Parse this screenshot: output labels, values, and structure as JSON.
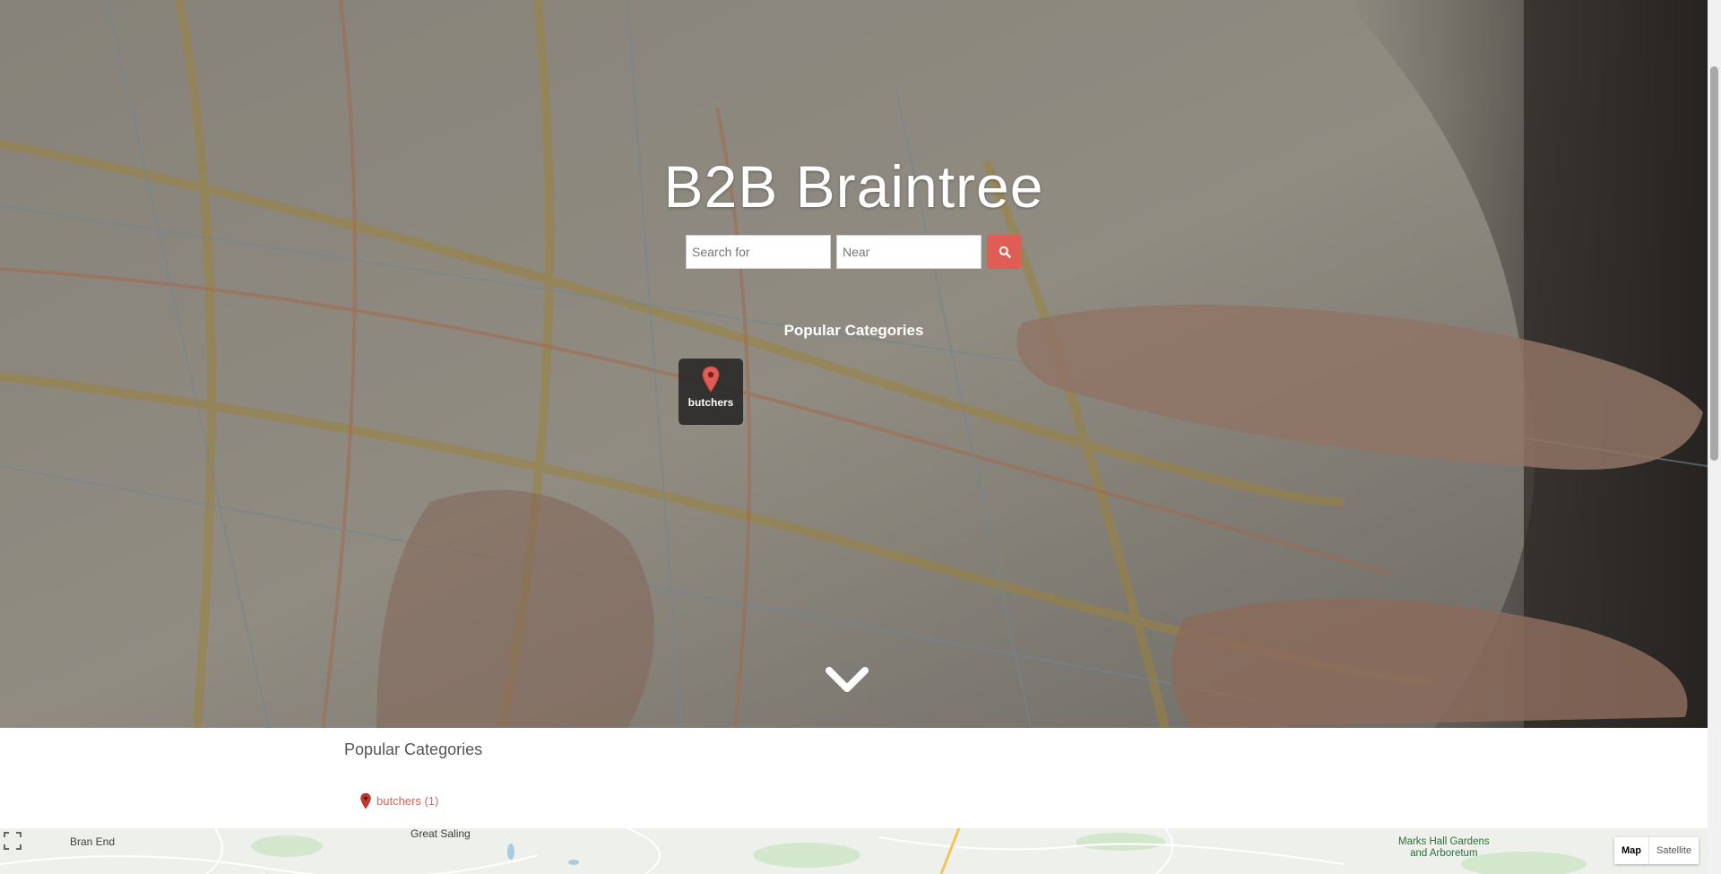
{
  "site": {
    "title": "B2B Braintree"
  },
  "search": {
    "what_placeholder": "Search for",
    "what_value": "",
    "near_placeholder": "Near",
    "near_value": "",
    "button_icon": "search-icon"
  },
  "hero": {
    "popular_heading": "Popular Categories",
    "categories": [
      {
        "label": "butchers",
        "icon": "map-pin-icon"
      }
    ],
    "scroll_icon": "chevron-down-icon"
  },
  "content": {
    "heading": "Popular Categories",
    "category_links": [
      {
        "label": "butchers (1)",
        "icon": "map-pin-icon"
      }
    ]
  },
  "map": {
    "place_labels": [
      "Bran End",
      "Great Saling",
      "Marks Hall Gardens\nand Arboretum"
    ],
    "type_options": [
      "Map",
      "Satellite"
    ],
    "selected_type": "Map",
    "fullscreen_icon": "fullscreen-icon"
  },
  "colors": {
    "accent": "#e05d56",
    "pin": "#e05d56",
    "tile_bg": "#1e1e1e",
    "heading_text": "#555555"
  }
}
